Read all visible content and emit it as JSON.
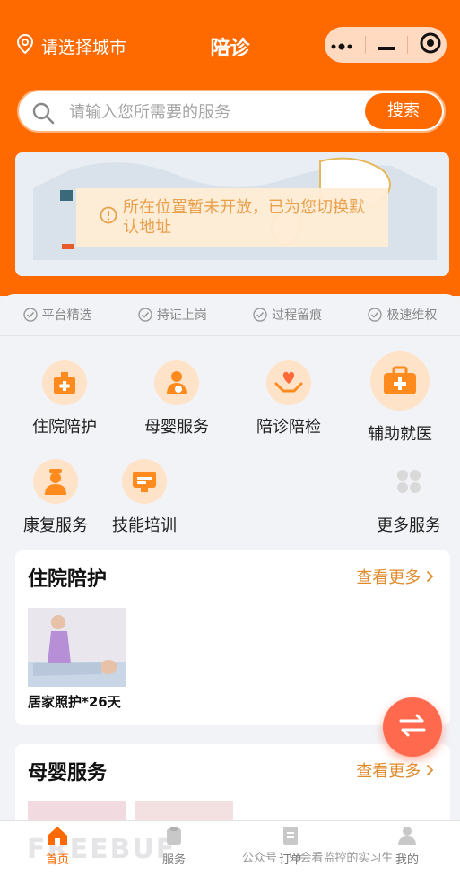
{
  "header": {
    "city_label": "请选择城市",
    "title": "陪诊",
    "capsule_icons": [
      "more-dots-icon",
      "minimize-icon",
      "target-icon"
    ]
  },
  "search": {
    "placeholder": "请输入您所需要的服务",
    "button": "搜索"
  },
  "banner": {
    "toast": "所在位置暂未开放，已为您切换默认地址"
  },
  "badges": [
    "平台精选",
    "持证上岗",
    "过程留痕",
    "极速维权"
  ],
  "services": [
    {
      "label": "住院陪护",
      "icon": "hospital-icon"
    },
    {
      "label": "母婴服务",
      "icon": "mother-baby-icon"
    },
    {
      "label": "陪诊陪检",
      "icon": "heart-hands-icon"
    },
    {
      "label": "辅助就医",
      "icon": "medical-kit-icon"
    },
    {
      "label": "康复服务",
      "icon": "nurse-icon"
    },
    {
      "label": "技能培训",
      "icon": "training-icon"
    },
    {
      "label": "更多服务",
      "icon": "grid-icon"
    }
  ],
  "sections": [
    {
      "title": "住院陪护",
      "more": "查看更多",
      "items": [
        {
          "caption": "居家照护*26天"
        }
      ]
    },
    {
      "title": "母婴服务",
      "more": "查看更多"
    }
  ],
  "tabbar": {
    "tabs": [
      "首页",
      "服务",
      "订单",
      "我的"
    ],
    "active": 0
  },
  "watermark": "公众号 · 只会看监控的实习生",
  "watermark_logo": "FREEBUF",
  "colors": {
    "accent": "#ff6a00",
    "link": "#e08b2c"
  }
}
